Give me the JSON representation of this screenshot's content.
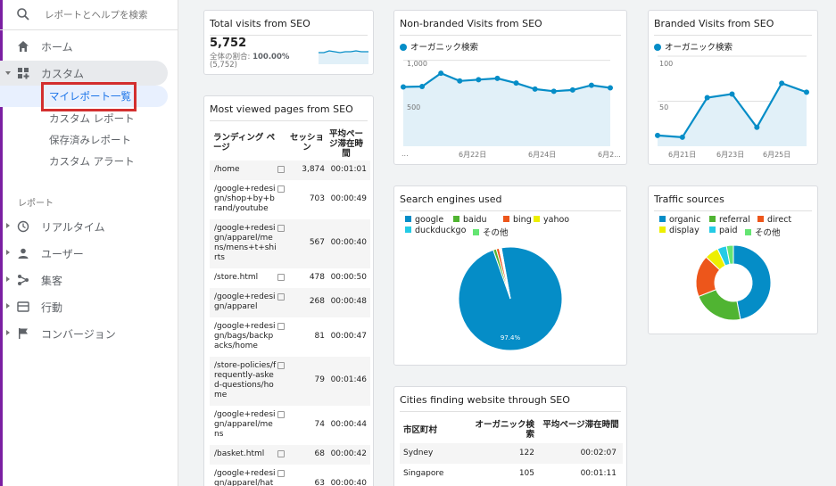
{
  "sidebar": {
    "search_placeholder": "レポートとヘルプを検索",
    "home": "ホーム",
    "custom": "カスタム",
    "custom_items": [
      "マイレポート一覧",
      "カスタム レポート",
      "保存済みレポート",
      "カスタム アラート"
    ],
    "reports_section": "レポート",
    "reports": [
      "リアルタイム",
      "ユーザー",
      "集客",
      "行動",
      "コンバージョン"
    ]
  },
  "highlight_color": "#d32f2f",
  "accent_color": "#7b1fa2",
  "chart_color": "#058dc7",
  "total_visits": {
    "title": "Total visits from SEO",
    "value": "5,752",
    "sub_label": "全体の割合:",
    "sub_value": "100.00%",
    "sub_total": "(5,752)"
  },
  "pages_table": {
    "title": "Most viewed pages from SEO",
    "headers": [
      "ランディング ページ",
      "セッション",
      "平均ページ滞在時間"
    ],
    "rows": [
      {
        "page": "/home",
        "sessions": "3,874",
        "time": "00:01:01"
      },
      {
        "page": "/google+redesign/shop+by+brand/youtube",
        "sessions": "703",
        "time": "00:00:49"
      },
      {
        "page": "/google+redesign/apparel/mens/mens+t+shirts",
        "sessions": "567",
        "time": "00:00:40"
      },
      {
        "page": "/store.html",
        "sessions": "478",
        "time": "00:00:50"
      },
      {
        "page": "/google+redesign/apparel",
        "sessions": "268",
        "time": "00:00:48"
      },
      {
        "page": "/google+redesign/bags/backpacks/home",
        "sessions": "81",
        "time": "00:00:47"
      },
      {
        "page": "/store-policies/frequently-asked-questions/home",
        "sessions": "79",
        "time": "00:01:46"
      },
      {
        "page": "/google+redesign/apparel/mens",
        "sessions": "74",
        "time": "00:00:44"
      },
      {
        "page": "/basket.html",
        "sessions": "68",
        "time": "00:00:42"
      },
      {
        "page": "/google+redesign/apparel/hat",
        "sessions": "63",
        "time": "00:00:40"
      }
    ]
  },
  "chart_data": [
    {
      "type": "area",
      "title": "Non-branded Visits from SEO",
      "series": [
        {
          "name": "オーガニック検索",
          "values": [
            690,
            695,
            850,
            760,
            775,
            790,
            735,
            665,
            640,
            655,
            710,
            680
          ]
        }
      ],
      "x_tick_labels": [
        "...",
        "6月22日",
        "6月24日",
        "6月2..."
      ],
      "y_tick_labels": [
        "1,000",
        "500"
      ],
      "ylim": [
        0,
        1100
      ]
    },
    {
      "type": "area",
      "title": "Branded Visits from SEO",
      "series": [
        {
          "name": "オーガニック検索",
          "values": [
            12,
            10,
            54,
            58,
            21,
            70,
            60
          ]
        }
      ],
      "x_tick_labels": [
        "6月21日",
        "6月23日",
        "6月25日"
      ],
      "y_tick_labels": [
        "100",
        "50"
      ],
      "ylim": [
        0,
        105
      ]
    },
    {
      "type": "pie",
      "title": "Search engines used",
      "categories": [
        "google",
        "baidu",
        "bing",
        "yahoo",
        "duckduckgo",
        "その他"
      ],
      "colors": [
        "#058dc7",
        "#50b432",
        "#ed561b",
        "#edef00",
        "#24cbe5",
        "#64e572"
      ],
      "values": [
        97.4,
        1.0,
        0.9,
        0.3,
        0.2,
        0.2
      ],
      "slice_label": "97.4%"
    },
    {
      "type": "pie",
      "title": "Traffic sources",
      "categories": [
        "organic",
        "referral",
        "direct",
        "display",
        "paid",
        "その他"
      ],
      "colors": [
        "#058dc7",
        "#50b432",
        "#ed561b",
        "#edef00",
        "#24cbe5",
        "#64e572"
      ],
      "values": [
        47,
        22,
        18,
        6,
        4,
        3
      ]
    }
  ],
  "cities_table": {
    "title": "Cities finding website through SEO",
    "headers": [
      "市区町村",
      "オーガニック検索",
      "平均ページ滞在時間"
    ],
    "rows": [
      {
        "city": "Sydney",
        "organic": "122",
        "time": "00:02:07"
      },
      {
        "city": "Singapore",
        "organic": "105",
        "time": "00:01:11"
      }
    ]
  }
}
